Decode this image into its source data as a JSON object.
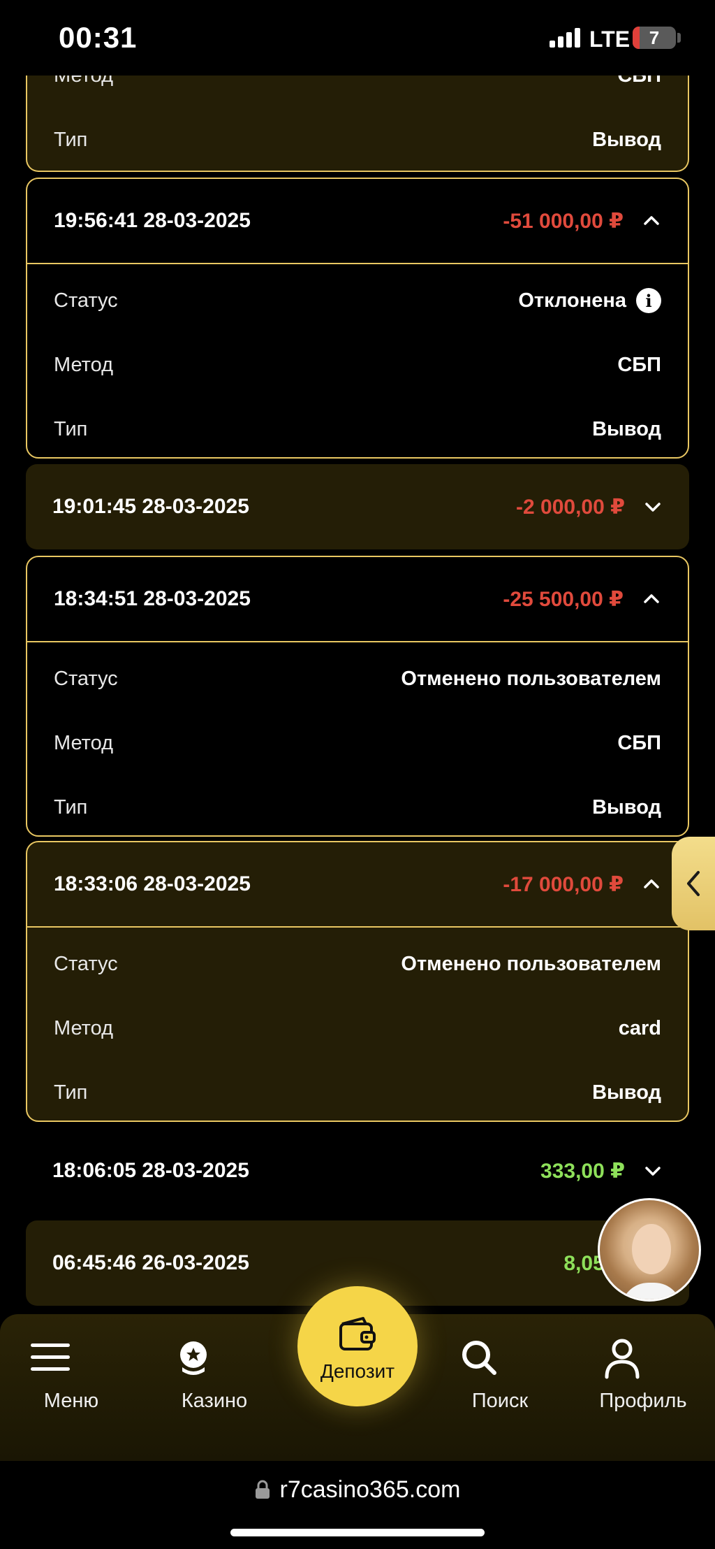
{
  "status_bar": {
    "time": "00:31",
    "network": "LTE",
    "battery": "7",
    "battery_level": 0.07
  },
  "labels": {
    "status": "Статус",
    "method": "Метод",
    "type": "Тип"
  },
  "partial_top_card": {
    "method_label": "Метод",
    "method_value": "СБП",
    "type_label": "Тип",
    "type_value": "Вывод"
  },
  "transactions": [
    {
      "datetime": "19:56:41 28-03-2025",
      "amount": "-51 000,00 ₽",
      "status": "Отклонена",
      "method": "СБП",
      "type": "Вывод"
    },
    {
      "datetime": "19:01:45 28-03-2025",
      "amount": "-2 000,00 ₽"
    },
    {
      "datetime": "18:34:51 28-03-2025",
      "amount": "-25 500,00 ₽",
      "status": "Отменено пользователем",
      "method": "СБП",
      "type": "Вывод"
    },
    {
      "datetime": "18:33:06 28-03-2025",
      "amount": "-17 000,00 ₽",
      "status": "Отменено пользователем",
      "method": "card",
      "type": "Вывод"
    },
    {
      "datetime": "18:06:05 28-03-2025",
      "amount": "333,00 ₽"
    },
    {
      "datetime": "06:45:46 26-03-2025",
      "amount": "8,05 ₽"
    }
  ],
  "bottom_nav": {
    "menu": "Меню",
    "casino": "Казино",
    "deposit": "Депозит",
    "search": "Поиск",
    "profile": "Профиль"
  },
  "browser": {
    "url": "r7casino365.com"
  },
  "colors": {
    "accent_gold": "#e9c762",
    "deposit_yellow": "#f5d548",
    "negative": "#e04a3c",
    "positive": "#8ee05a",
    "card_olive": "#241e06"
  },
  "icons": {
    "side_tab": "chevron-left-icon",
    "avatar": "support-avatar"
  }
}
